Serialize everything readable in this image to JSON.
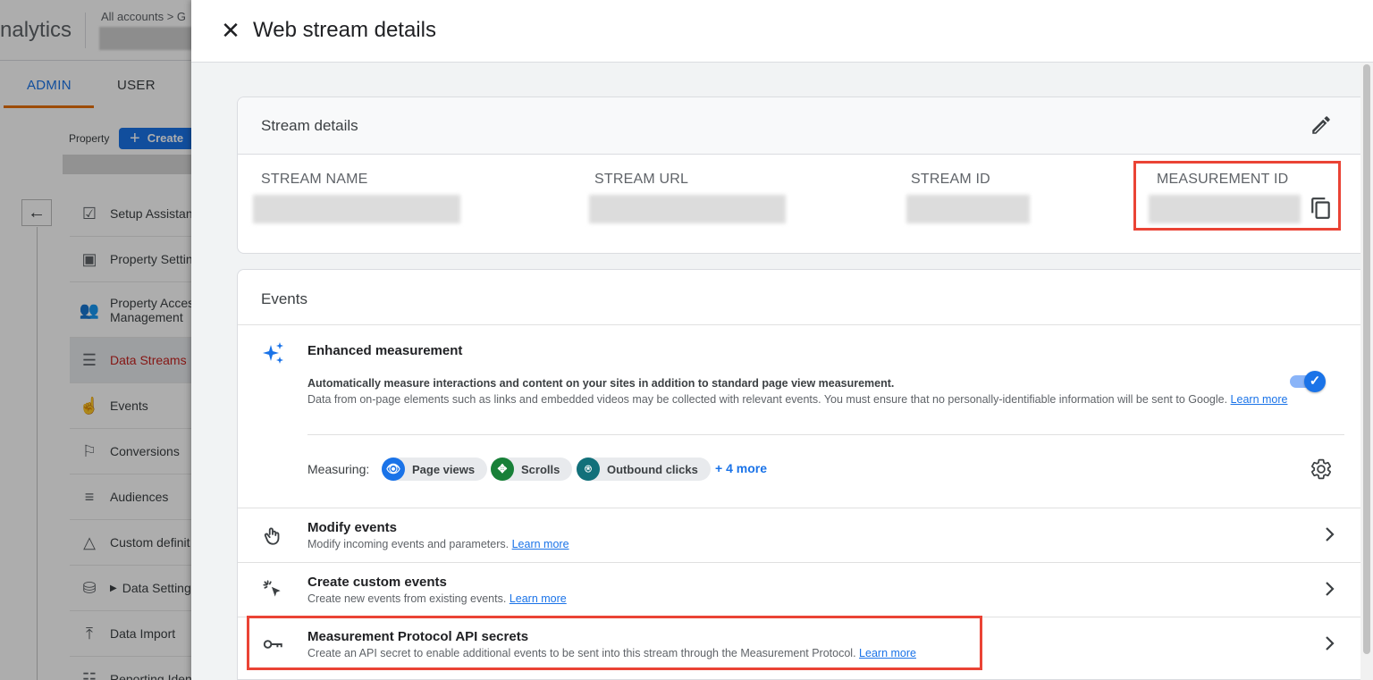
{
  "background": {
    "logo_text": "nalytics",
    "breadcrumb": "All accounts > G",
    "tabs": [
      "ADMIN",
      "USER"
    ],
    "property_label": "Property",
    "create_label": "Create",
    "nav": [
      {
        "icon": "setup-assistant-icon",
        "label": "Setup Assistan"
      },
      {
        "icon": "property-settings-icon",
        "label": "Property Settin"
      },
      {
        "icon": "property-access-icon",
        "label": "Property Acces\nManagement"
      },
      {
        "icon": "data-streams-icon",
        "label": "Data Streams"
      },
      {
        "icon": "events-icon",
        "label": "Events"
      },
      {
        "icon": "conversions-icon",
        "label": "Conversions"
      },
      {
        "icon": "audiences-icon",
        "label": "Audiences"
      },
      {
        "icon": "custom-definitions-icon",
        "label": "Custom definit"
      },
      {
        "icon": "data-settings-icon",
        "label": "Data Setting"
      },
      {
        "icon": "data-import-icon",
        "label": "Data Import"
      },
      {
        "icon": "reporting-identity-icon",
        "label": "Reporting Iden"
      }
    ]
  },
  "drawer": {
    "title": "Web stream details",
    "stream_details": {
      "title": "Stream details",
      "fields": [
        {
          "label": "STREAM NAME"
        },
        {
          "label": "STREAM URL"
        },
        {
          "label": "STREAM ID"
        },
        {
          "label": "MEASUREMENT ID"
        }
      ]
    },
    "events": {
      "title": "Events",
      "enhanced": {
        "title": "Enhanced measurement",
        "desc_bold": "Automatically measure interactions and content on your sites in addition to standard page view measurement.",
        "desc": "Data from on-page elements such as links and embedded videos may be collected with relevant events. You must ensure that no personally-identifiable information will be sent to Google.",
        "learn_more": "Learn more",
        "enabled": true,
        "measuring_label": "Measuring:",
        "chips": [
          {
            "label": "Page views",
            "icon": "eye-icon",
            "color": "#1a73e8"
          },
          {
            "label": "Scrolls",
            "icon": "scroll-icon",
            "color": "#188038"
          },
          {
            "label": "Outbound clicks",
            "icon": "mouse-icon",
            "color": "#12707a"
          }
        ],
        "more": "+ 4 more"
      },
      "rows": [
        {
          "title": "Modify events",
          "sub": "Modify incoming events and parameters.",
          "learn_more": "Learn more"
        },
        {
          "title": "Create custom events",
          "sub": "Create new events from existing events.",
          "learn_more": "Learn more"
        },
        {
          "title": "Measurement Protocol API secrets",
          "sub": "Create an API secret to enable additional events to be sent into this stream through the Measurement Protocol.",
          "learn_more": "Learn more"
        }
      ]
    }
  },
  "colors": {
    "accent": "#1a73e8",
    "highlight": "#ea4335",
    "active_nav": "#c5221f"
  }
}
